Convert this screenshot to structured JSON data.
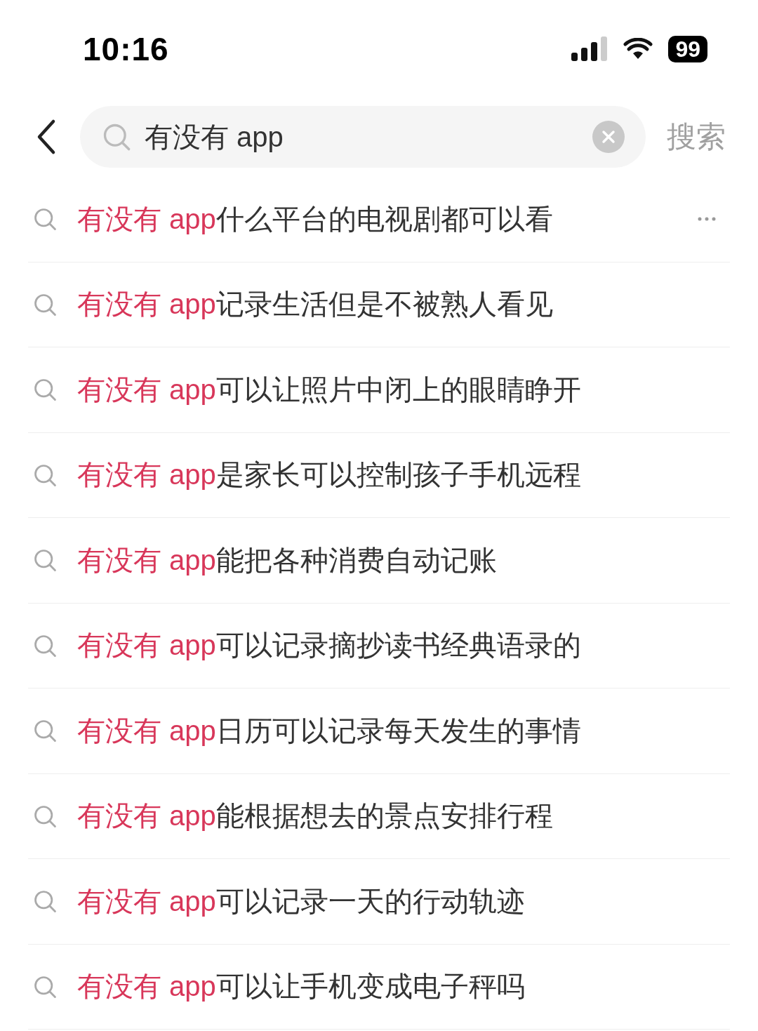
{
  "status_bar": {
    "time": "10:16",
    "battery": "99"
  },
  "search": {
    "value": "有没有 app",
    "action": "搜索"
  },
  "suggestions": [
    {
      "highlight": "有没有 app",
      "rest": "什么平台的电视剧都可以看",
      "more": true
    },
    {
      "highlight": "有没有 app",
      "rest": "记录生活但是不被熟人看见",
      "more": false
    },
    {
      "highlight": "有没有 app",
      "rest": "可以让照片中闭上的眼睛睁开",
      "more": false
    },
    {
      "highlight": "有没有 app",
      "rest": "是家长可以控制孩子手机远程",
      "more": false
    },
    {
      "highlight": "有没有 app",
      "rest": "能把各种消费自动记账",
      "more": false
    },
    {
      "highlight": "有没有 app",
      "rest": "可以记录摘抄读书经典语录的",
      "more": false
    },
    {
      "highlight": "有没有 app",
      "rest": "日历可以记录每天发生的事情",
      "more": false
    },
    {
      "highlight": "有没有 app",
      "rest": "能根据想去的景点安排行程",
      "more": false
    },
    {
      "highlight": "有没有 app",
      "rest": "可以记录一天的行动轨迹",
      "more": false
    },
    {
      "highlight": "有没有 app",
      "rest": "可以让手机变成电子秤吗",
      "more": false
    }
  ]
}
